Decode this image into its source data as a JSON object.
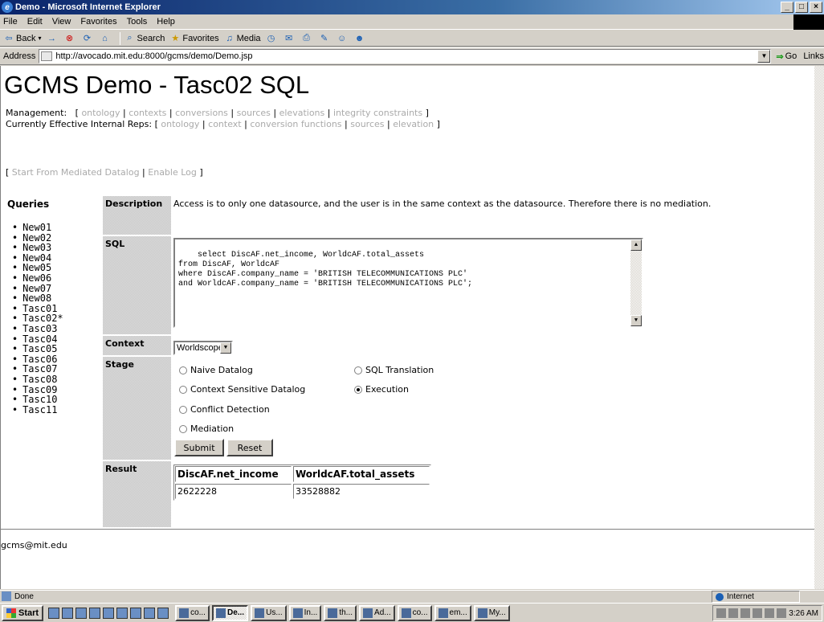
{
  "window": {
    "title": "Demo - Microsoft Internet Explorer",
    "minimize": "_",
    "maximize": "□",
    "close": "×"
  },
  "menu": [
    "File",
    "Edit",
    "View",
    "Favorites",
    "Tools",
    "Help"
  ],
  "toolbar": {
    "back": "Back",
    "search": "Search",
    "favorites": "Favorites",
    "media": "Media"
  },
  "address": {
    "label": "Address",
    "url": "http://avocado.mit.edu:8000/gcms/demo/Demo.jsp",
    "go": "Go",
    "links": "Links"
  },
  "page": {
    "title": "GCMS Demo - Tasc02 SQL",
    "management_label": "Management:",
    "management_links": [
      "ontology",
      "contexts",
      "conversions",
      "sources",
      "elevations",
      "integrity constraints"
    ],
    "internal_label": "Currently Effective Internal Reps:",
    "internal_links": [
      "ontology",
      "context",
      "conversion functions",
      "sources",
      "elevation"
    ],
    "start_links": [
      "Start From Mediated Datalog",
      "Enable Log"
    ],
    "queries_title": "Queries",
    "queries": [
      "New01",
      "New02",
      "New03",
      "New04",
      "New05",
      "New06",
      "New07",
      "New08",
      "Tasc01",
      "Tasc02*",
      "Tasc03",
      "Tasc04",
      "Tasc05",
      "Tasc06",
      "Tasc07",
      "Tasc08",
      "Tasc09",
      "Tasc10",
      "Tasc11"
    ],
    "labels": {
      "description": "Description",
      "sql": "SQL",
      "context": "Context",
      "stage": "Stage",
      "result": "Result"
    },
    "description": "Access is to only one datasource, and the user is in the same context as the datasource. Therefore there is no mediation.",
    "sql": "select DiscAF.net_income, WorldcAF.total_assets\nfrom DiscAF, WorldcAF\nwhere DiscAF.company_name = 'BRITISH TELECOMMUNICATIONS PLC'\nand WorldcAF.company_name = 'BRITISH TELECOMMUNICATIONS PLC';",
    "context_value": "Worldscope",
    "stages": {
      "naive": "Naive Datalog",
      "sql_translation": "SQL Translation",
      "context_sensitive": "Context Sensitive Datalog",
      "execution": "Execution",
      "conflict": "Conflict Detection",
      "mediation": "Mediation"
    },
    "selected_stage": "Execution",
    "submit": "Submit",
    "reset": "Reset",
    "result": {
      "headers": [
        "DiscAF.net_income",
        "WorldcAF.total_assets"
      ],
      "rows": [
        [
          "2622228",
          "33528882"
        ]
      ]
    },
    "footer": "gcms@mit.edu"
  },
  "status": {
    "text": "Done",
    "zone": "Internet"
  },
  "taskbar": {
    "start": "Start",
    "buttons": [
      "co...",
      "De...",
      "Us...",
      "In...",
      "th...",
      "Ad...",
      "co...",
      "em...",
      "My..."
    ],
    "active_index": 1,
    "clock": "3:26 AM"
  }
}
